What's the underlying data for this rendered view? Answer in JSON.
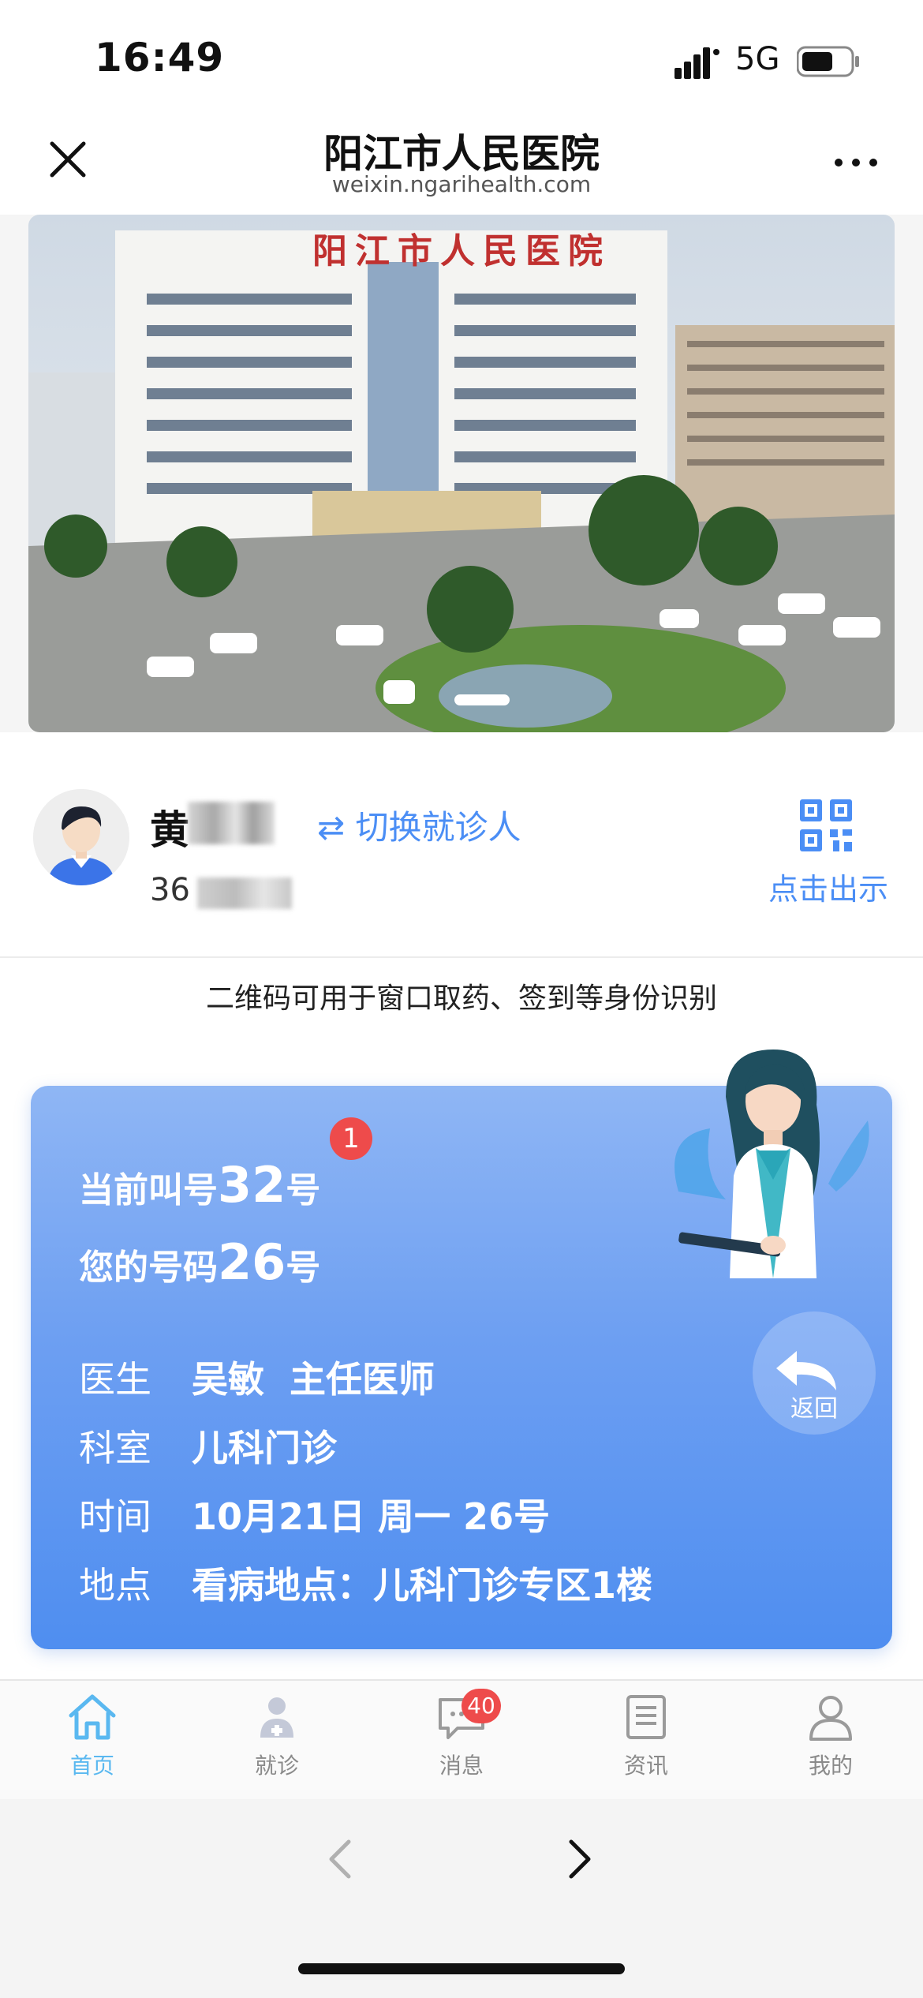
{
  "status_bar": {
    "time": "16:49",
    "network": "5G"
  },
  "nav": {
    "title": "阳江市人民医院",
    "domain": "weixin.ngarihealth.com"
  },
  "banner": {
    "sign_text": "阳江市人民医院"
  },
  "patient": {
    "name_visible": "黄",
    "id_visible": "36",
    "switch_label": "⇄ 切换就诊人",
    "qr_label": "点击出示"
  },
  "qr_note": "二维码可用于窗口取药、签到等身份识别",
  "queue": {
    "current_prefix": "当前叫号",
    "current_number": "32",
    "current_suffix": "号",
    "badge": "1",
    "your_prefix": "您的号码",
    "your_number": "26",
    "your_suffix": "号",
    "rows": [
      {
        "key": "医生",
        "value": "吴敏  主任医师"
      },
      {
        "key": "科室",
        "value": "儿科门诊"
      },
      {
        "key": "时间",
        "value": "10月21日 周一 26号"
      },
      {
        "key": "地点",
        "value": "看病地点：儿科门诊专区1楼"
      }
    ],
    "back_label": "返回"
  },
  "tabs": [
    {
      "label": "首页",
      "icon": "home-icon",
      "active": true
    },
    {
      "label": "就诊",
      "icon": "doctor-icon",
      "active": false
    },
    {
      "label": "消息",
      "icon": "message-icon",
      "active": false
    },
    {
      "label": "资讯",
      "icon": "news-icon",
      "active": false
    },
    {
      "label": "我的",
      "icon": "profile-icon",
      "active": false
    }
  ],
  "message_badge": "40",
  "colors": {
    "accent": "#4b8ef5",
    "card_top": "#8fb6f4",
    "card_bottom": "#4f8ef0",
    "badge": "#ee4b4b",
    "tab_active": "#5ab8f0"
  }
}
